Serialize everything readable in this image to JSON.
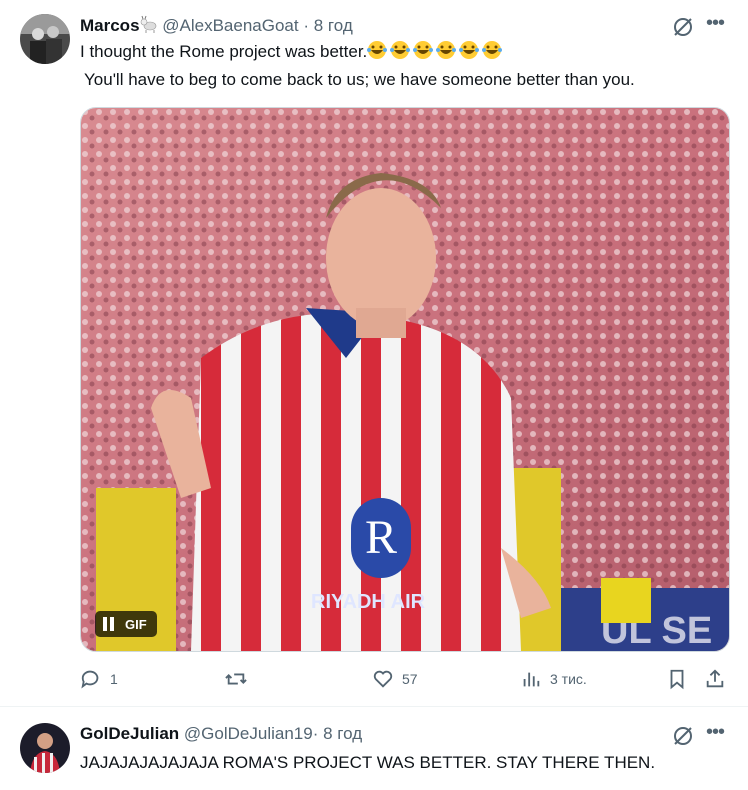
{
  "tweets": [
    {
      "display_name": "Marcos",
      "handle": "@AlexBaenaGoat",
      "separator": "·",
      "time": "8 год",
      "text_line1": "I thought the Rome project was better.",
      "text_line2": "You'll have to beg to come back to us; we have someone better than you.",
      "emoji_count": 6,
      "media_badge": "GIF",
      "stats": {
        "replies": "1",
        "reposts": "",
        "likes": "57",
        "views": "3 тис."
      }
    },
    {
      "display_name": "GolDeJulian",
      "handle": "@GolDeJulian19",
      "separator": "·",
      "time": "8 год",
      "text_line1": "JAJAJAJAJAJAJA ROMA'S PROJECT WAS BETTER. STAY THERE THEN."
    }
  ],
  "icons": [
    "goat-icon",
    "grok-icon",
    "more-icon",
    "reply-icon",
    "repost-icon",
    "like-icon",
    "views-icon",
    "bookmark-icon",
    "share-icon",
    "pause-icon"
  ],
  "colors": {
    "text": "#0f1419",
    "secondary": "#536471",
    "border": "#eff3f4"
  }
}
